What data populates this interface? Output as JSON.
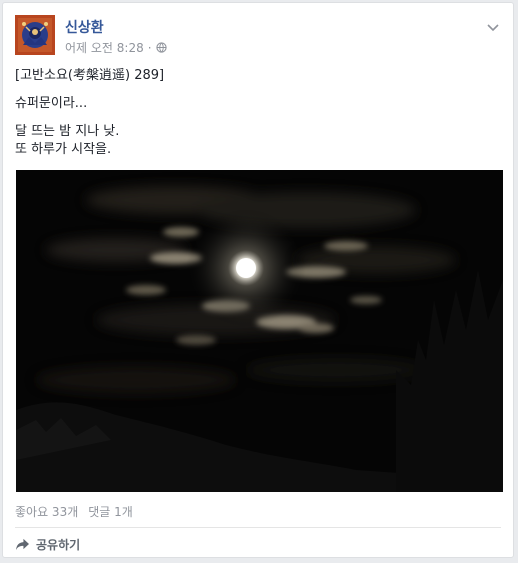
{
  "post": {
    "author": "신상환",
    "time": "어제 오전 8:28",
    "separator": "·",
    "privacy_icon": "globe-icon",
    "options_icon": "chevron-down-icon",
    "lines": [
      "[고반소요(考槃逍遥) 289]",
      "슈퍼문이라...",
      "달 뜨는 밤 지나 낮.",
      "또 하루가 시작을."
    ],
    "photo_alt": "night-moon-clouds-photo"
  },
  "stats": {
    "likes": "좋아요 33개",
    "comments": "댓글 1개"
  },
  "actions": {
    "share_icon": "share-arrow-icon",
    "share_label": "공유하기"
  },
  "colors": {
    "author": "#365899",
    "meta": "#90949c",
    "text": "#1d2129",
    "background": "#e9ebee"
  }
}
